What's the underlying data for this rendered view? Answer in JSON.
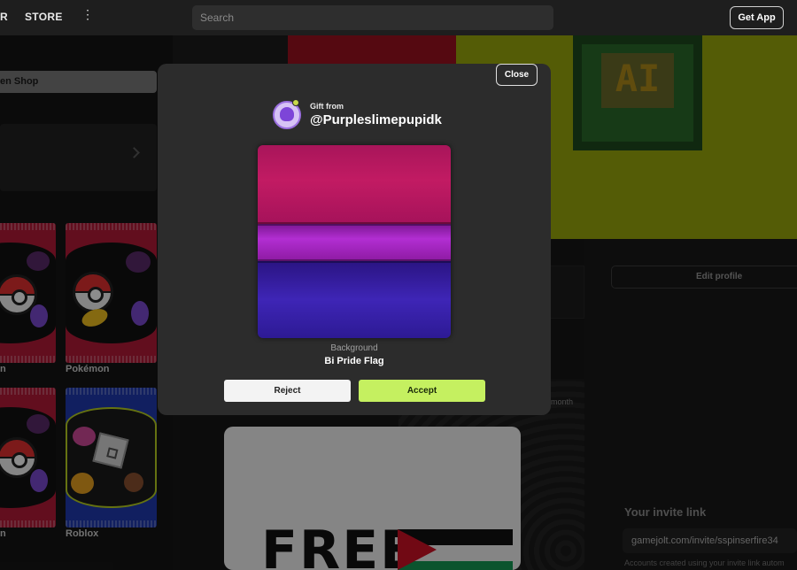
{
  "topbar": {
    "nav_partial": "R",
    "store": "STORE",
    "more_icon": "kebab-menu-icon",
    "search_placeholder": "Search",
    "get_app": "Get App"
  },
  "left_panel": {
    "shop_button": "en Shop",
    "packs": [
      {
        "label": "n",
        "theme": "pokemon",
        "color": "#b31a38"
      },
      {
        "label": "Pokémon",
        "theme": "pokemon",
        "color": "#b31a38"
      },
      {
        "label": "n",
        "theme": "pokemon",
        "color": "#b31a38"
      },
      {
        "label": "Roblox",
        "theme": "roblox",
        "color": "#1f3ab0"
      }
    ]
  },
  "profile": {
    "edit_profile": "Edit profile",
    "month_fragment": "month",
    "invite_title": "Your invite link",
    "invite_link": "gamejolt.com/invite/sspinserfire34",
    "invite_note": "Accounts created using your invite link autom"
  },
  "post": {
    "free_text": "FREE"
  },
  "modal": {
    "close": "Close",
    "gift_from": "Gift from",
    "username": "@Purpleslimepupidk",
    "item_kind": "Background",
    "item_name": "Bi Pride Flag",
    "reject": "Reject",
    "accept": "Accept",
    "colors": {
      "pink": "#c21b63",
      "purple": "#b22ed2",
      "blue": "#3e25b6",
      "accept": "#c5f060"
    }
  }
}
